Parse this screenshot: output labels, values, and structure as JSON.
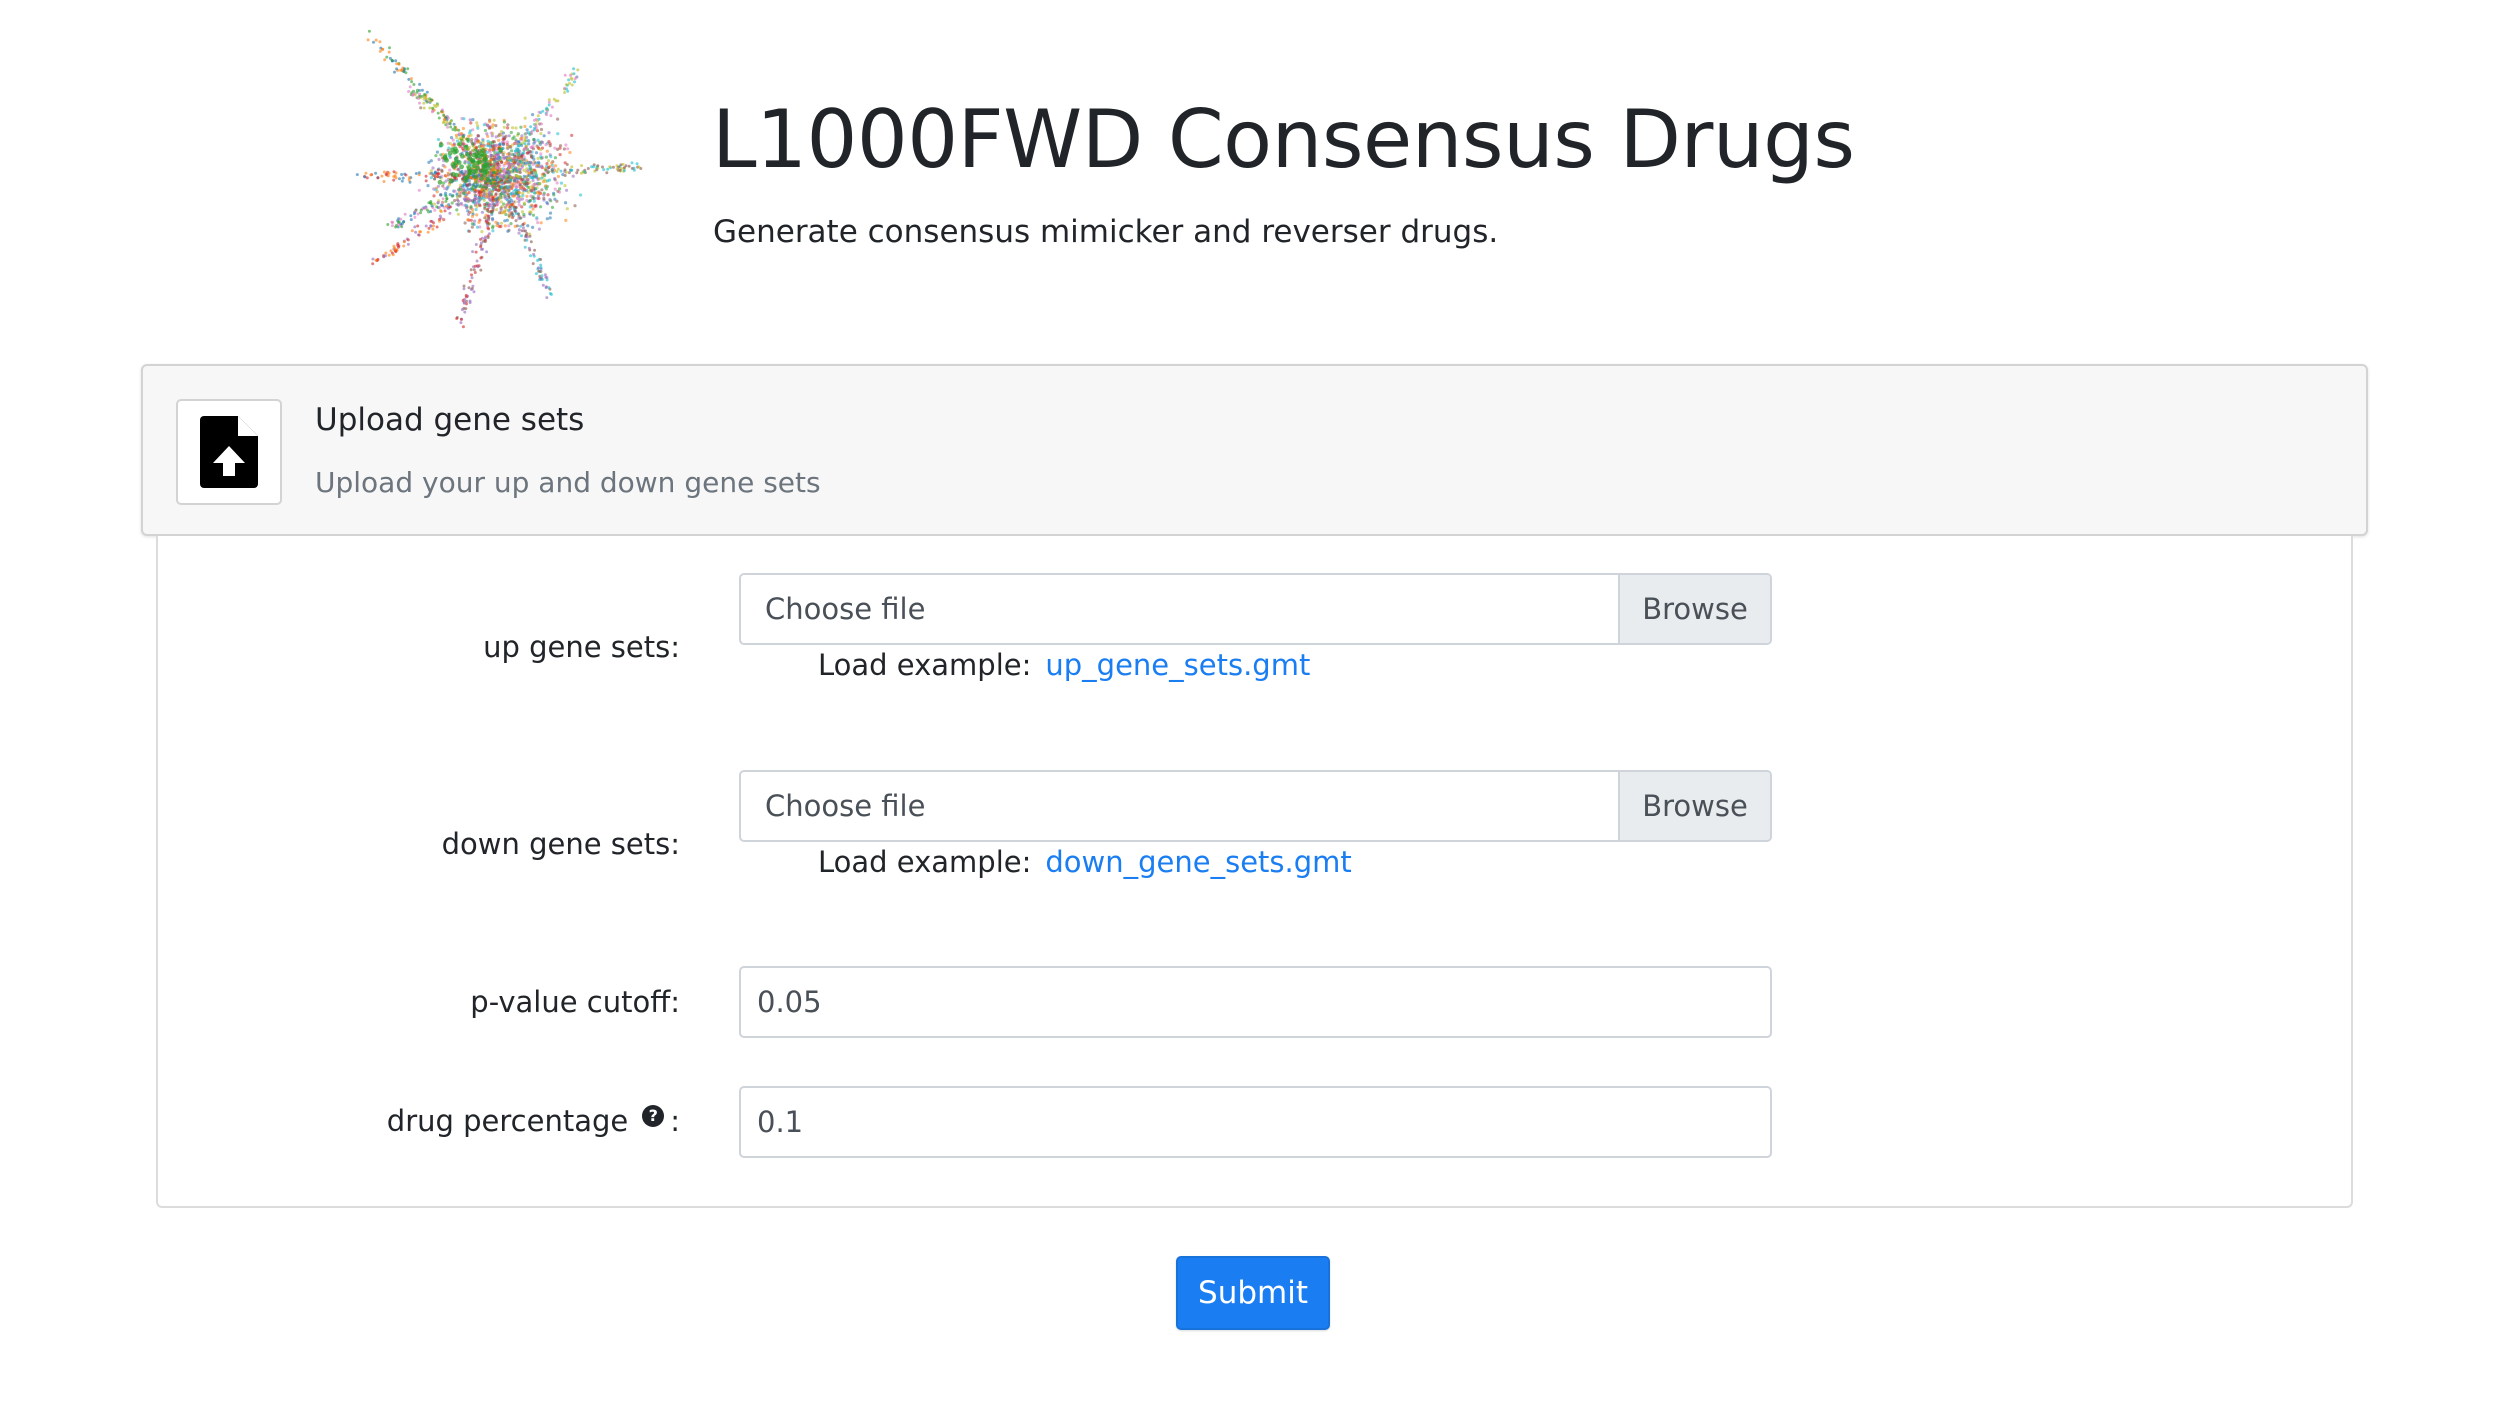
{
  "header": {
    "title": "L1000FWD Consensus Drugs",
    "subtitle": "Generate consensus mimicker and reverser drugs."
  },
  "card": {
    "title": "Upload gene sets",
    "description": "Upload your up and down gene sets",
    "icon": "file-upload-icon"
  },
  "form": {
    "up": {
      "label": "up gene sets:",
      "placeholder": "Choose file",
      "browse_label": "Browse",
      "example_prefix": "Load example:",
      "example_link": "up_gene_sets.gmt"
    },
    "down": {
      "label": "down gene sets:",
      "placeholder": "Choose file",
      "browse_label": "Browse",
      "example_prefix": "Load example:",
      "example_link": "down_gene_sets.gmt"
    },
    "pvalue": {
      "label": "p-value cutoff:",
      "value": "0.05"
    },
    "drug_pct": {
      "label": "drug percentage",
      "colon": ":",
      "help_icon": "question-circle-icon",
      "value": "0.1"
    },
    "submit_label": "Submit"
  },
  "colors": {
    "primary": "#1a7ef2",
    "link": "#1a7ef2",
    "card_header_bg": "#f7f7f7",
    "muted_text": "#6c757d"
  }
}
